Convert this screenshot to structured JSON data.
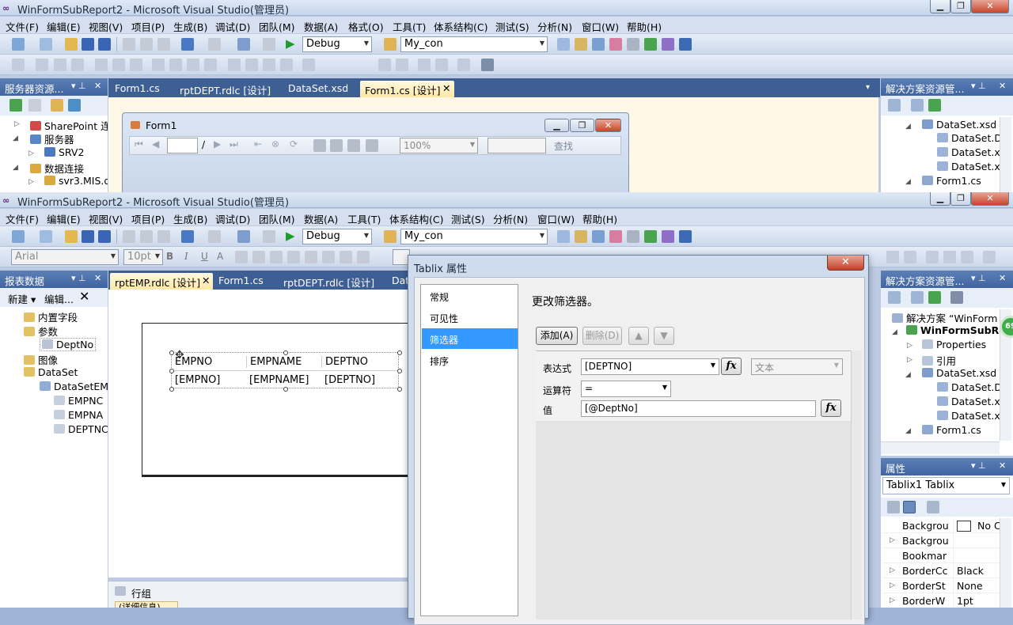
{
  "back_window": {
    "title": "WinFormSubReport2 - Microsoft Visual Studio(管理员)",
    "menu": [
      "文件(F)",
      "编辑(E)",
      "视图(V)",
      "项目(P)",
      "生成(B)",
      "调试(D)",
      "团队(M)",
      "数据(A)",
      "格式(O)",
      "工具(T)",
      "体系结构(C)",
      "测试(S)",
      "分析(N)",
      "窗口(W)",
      "帮助(H)"
    ],
    "config": "Debug",
    "target": "My_con",
    "server_panel": {
      "title": "服务器资源...",
      "items": [
        "SharePoint 连",
        "服务器",
        "SRV2",
        "数据连接",
        "svr3.MIS.d"
      ]
    },
    "tabs": [
      "Form1.cs",
      "rptDEPT.rdlc [设计]",
      "DataSet.xsd",
      "Form1.cs [设计]"
    ],
    "form": {
      "title": "Form1",
      "page_sep": "/",
      "zoom": "100%",
      "find": "查找"
    },
    "solution_panel": {
      "title": "解决方案资源管...",
      "items": [
        "DataSet.xsd",
        "DataSet.D",
        "DataSet.x",
        "DataSet.x",
        "Form1.cs"
      ]
    }
  },
  "front_window": {
    "title": "WinFormSubReport2 - Microsoft Visual Studio(管理员)",
    "menu": [
      "文件(F)",
      "编辑(E)",
      "视图(V)",
      "项目(P)",
      "生成(B)",
      "调试(D)",
      "团队(M)",
      "数据(A)",
      "工具(T)",
      "体系结构(C)",
      "测试(S)",
      "分析(N)",
      "窗口(W)",
      "帮助(H)"
    ],
    "config": "Debug",
    "target": "My_con",
    "font_name": "Arial",
    "font_size": "10pt",
    "report_data": {
      "title": "报表数据",
      "new_label": "新建 ▾",
      "edit_label": "编辑...",
      "items": [
        "内置字段",
        "参数",
        "DeptNo",
        "图像",
        "DataSet",
        "DataSetEM",
        "EMPNC",
        "EMPNA",
        "DEPTNC"
      ]
    },
    "tabs": [
      "rptEMP.rdlc [设计]",
      "Form1.cs",
      "rptDEPT.rdlc [设计]",
      "Dat"
    ],
    "tablix": {
      "headers": [
        "EMPNO",
        "EMPNAME",
        "DEPTNO"
      ],
      "cells": [
        "[EMPNO]",
        "[EMPNAME]",
        "[DEPTNO]"
      ]
    },
    "row_groups_label": "行组",
    "details_label": "(详细信息)",
    "solution_panel": {
      "title": "解决方案资源管...",
      "items": [
        "解决方案 “WinForm",
        "WinFormSubRe",
        "Properties",
        "引用",
        "DataSet.xsd",
        "DataSet.D",
        "DataSet.x",
        "DataSet.x",
        "Form1.cs"
      ],
      "badge": "69"
    },
    "properties_panel": {
      "title": "属性",
      "object": "Tablix1  Tablix",
      "rows": [
        {
          "name": "Backgrou",
          "value": "No Co"
        },
        {
          "name": "Backgrou",
          "value": ""
        },
        {
          "name": "Bookmar",
          "value": ""
        },
        {
          "name": "BorderCc",
          "value": "Black"
        },
        {
          "name": "BorderSt",
          "value": "None"
        },
        {
          "name": "BorderW",
          "value": "1pt"
        }
      ]
    }
  },
  "dialog": {
    "title": "Tablix 属性",
    "close": "✕",
    "nav": [
      "常规",
      "可见性",
      "筛选器",
      "排序"
    ],
    "selected_nav": 2,
    "heading": "更改筛选器。",
    "add": "添加(A)",
    "delete": "删除(D)",
    "expression_label": "表达式",
    "expression_value": "[DEPTNO]",
    "type_value": "文本",
    "operator_label": "运算符",
    "operator_value": "=",
    "value_label": "值",
    "value_value": "[@DeptNo]",
    "fx": "fx"
  }
}
